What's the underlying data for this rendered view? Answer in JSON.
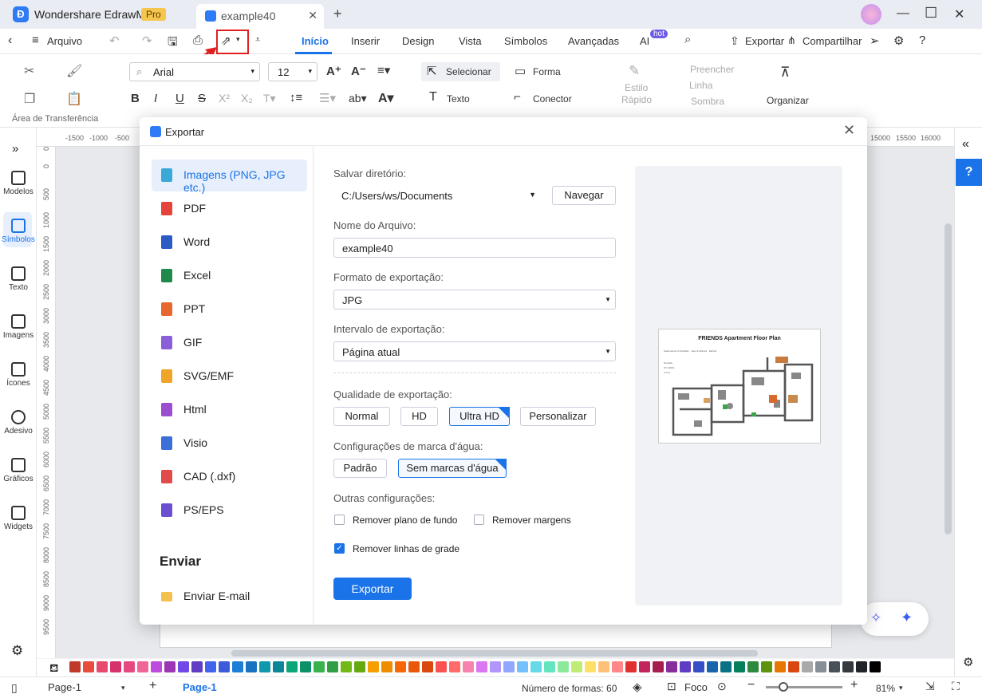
{
  "app": {
    "name": "Wondershare EdrawMax",
    "badge": "Pro",
    "tab": "example40"
  },
  "menubar": {
    "file": "Arquivo",
    "tabs": [
      "Início",
      "Inserir",
      "Design",
      "Vista",
      "Símbolos",
      "Avançadas",
      "AI"
    ],
    "hot": "hot",
    "export": "Exportar",
    "share": "Compartilhar"
  },
  "ribbon": {
    "font": "Arial",
    "size": "12",
    "select": "Selecionar",
    "shape": "Forma",
    "text": "Texto",
    "connector": "Conector",
    "quick_style": "Estilo",
    "quick_style2": "Rápido",
    "fill": "Preencher",
    "line": "Linha",
    "shadow": "Sombra",
    "arrange": "Organizar",
    "clipboard": "Área de Transferência"
  },
  "rail": [
    "Modelos",
    "Símbolos",
    "Texto",
    "Imagens",
    "Ícones",
    "Adesivo",
    "Gráficos",
    "Widgets"
  ],
  "ruler": {
    "top": [
      "-1500",
      "-1000",
      "-500",
      "15000",
      "15500",
      "16000"
    ],
    "left": [
      "0",
      "500",
      "1000",
      "1500",
      "2000",
      "2500",
      "3000",
      "3500",
      "4000",
      "4500",
      "5000",
      "5500",
      "6000",
      "6500",
      "7000",
      "7500",
      "8000",
      "8500",
      "9000",
      "9500"
    ]
  },
  "dialog": {
    "title": "Exportar",
    "formats": [
      "Imagens (PNG, JPG etc.)",
      "PDF",
      "Word",
      "Excel",
      "PPT",
      "GIF",
      "SVG/EMF",
      "Html",
      "Visio",
      "CAD (.dxf)",
      "PS/EPS"
    ],
    "send_title": "Enviar",
    "send_email": "Enviar E-mail",
    "dir_label": "Salvar diretório:",
    "dir_value": "C:/Users/ws/Documents",
    "browse": "Navegar",
    "name_label": "Nome do Arquivo:",
    "name_value": "example40",
    "format_label": "Formato de exportação:",
    "format_value": "JPG",
    "range_label": "Intervalo de exportação:",
    "range_value": "Página atual",
    "quality_label": "Qualidade de exportação:",
    "quality": [
      "Normal",
      "HD",
      "Ultra HD",
      "Personalizar"
    ],
    "watermark_label": "Configurações de marca d'água:",
    "watermark": [
      "Padrão",
      "Sem marcas d'água"
    ],
    "other_label": "Outras configurações:",
    "remove_bg": "Remover plano de fundo",
    "remove_margins": "Remover margens",
    "remove_grid": "Remover linhas de grade",
    "export_btn": "Exportar",
    "preview_title": "FRIENDS Apartment Floor Plan",
    "preview_sub": "Apartments of Chandler · Joey & Monica · Rachel",
    "preview_addr1": "Newtork",
    "preview_addr2": "NY 10010",
    "preview_addr3": "U.S.A."
  },
  "status": {
    "page_sel": "Page-1",
    "page_tab": "Page-1",
    "shapes": "Número de formas: 60",
    "focus": "Foco",
    "zoom": "81%"
  },
  "palette": [
    "#c0392b",
    "#e74c3c",
    "#e84a6f",
    "#d6336c",
    "#e64980",
    "#f06595",
    "#be4bdb",
    "#9c36b5",
    "#7048e8",
    "#5f3dc4",
    "#4263eb",
    "#3b5bdb",
    "#1c7ed6",
    "#1971c2",
    "#1098ad",
    "#0c8599",
    "#0ca678",
    "#099268",
    "#37b24d",
    "#2f9e44",
    "#74b816",
    "#66a80f",
    "#f59f00",
    "#f08c00",
    "#f76707",
    "#e8590c",
    "#d9480f",
    "#fa5252",
    "#ff6b6b",
    "#f783ac",
    "#da77f2",
    "#b197fc",
    "#91a7ff",
    "#74c0fc",
    "#66d9e8",
    "#63e6be",
    "#8ce99a",
    "#c0eb75",
    "#ffe066",
    "#ffc078",
    "#ff8787",
    "#e03131",
    "#c2255c",
    "#a61e4d",
    "#862e9c",
    "#5f3dc4",
    "#364fc7",
    "#1864ab",
    "#0b7285",
    "#087f5b",
    "#2b8a3e",
    "#5c940d",
    "#e67700",
    "#d9480f",
    "#a9a9a9",
    "#868e96",
    "#495057",
    "#343a40",
    "#212529",
    "#000000"
  ]
}
